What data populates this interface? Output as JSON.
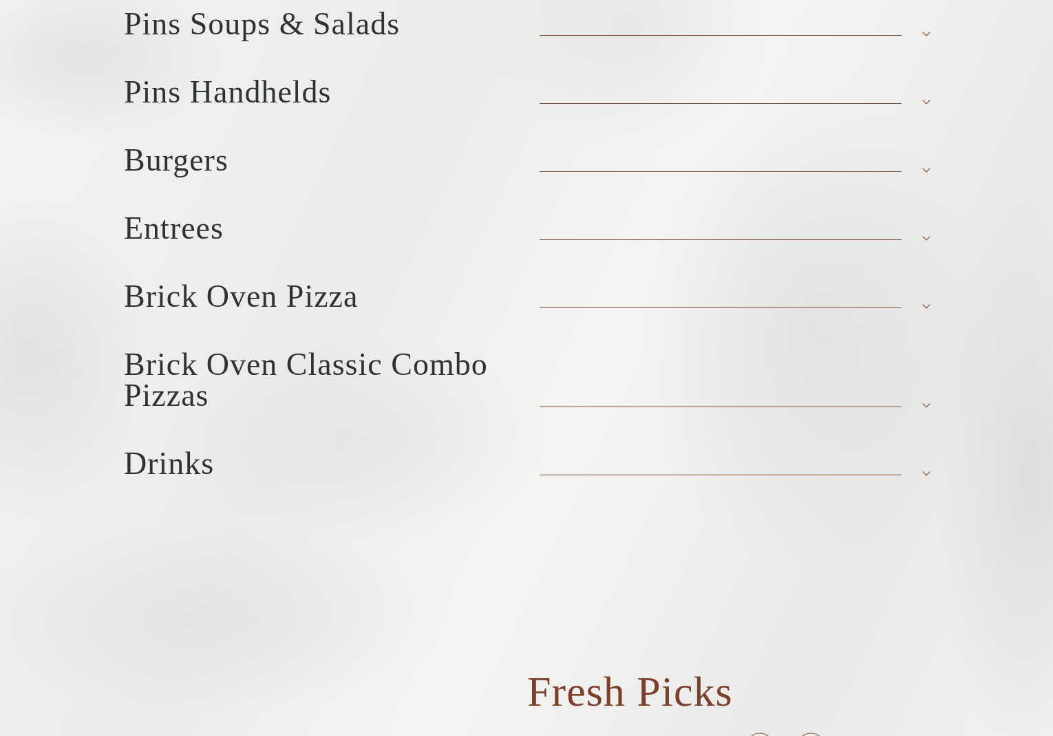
{
  "menu_categories": [
    {
      "title": "Pins Soups & Salads",
      "expanded": false
    },
    {
      "title": "Pins Handhelds",
      "expanded": false
    },
    {
      "title": "Burgers",
      "expanded": false
    },
    {
      "title": "Entrees",
      "expanded": false
    },
    {
      "title": "Brick Oven Pizza",
      "expanded": false
    },
    {
      "title": "Brick Oven Classic Combo Pizzas",
      "expanded": false
    },
    {
      "title": "Drinks",
      "expanded": false
    }
  ],
  "featured_section": {
    "title": "Fresh Picks"
  }
}
